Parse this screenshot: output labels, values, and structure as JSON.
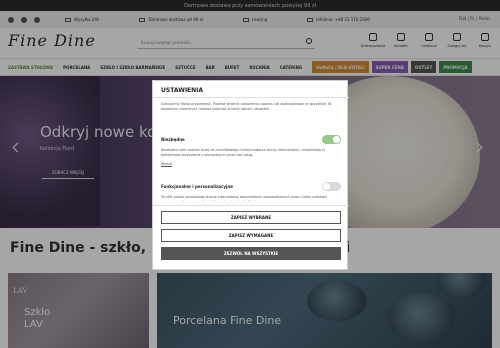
{
  "topbar": {
    "text": "Darmowa dostawa przy zamówieniach powyżej 99 zł"
  },
  "infobar": {
    "social": [
      "facebook-icon",
      "instagram-icon",
      "youtube-icon"
    ],
    "items": [
      "Wysyłka 24h",
      "Darmowa dostawa od 99 zł",
      "Leasing",
      "Infolinia: +48 22 110 2606"
    ],
    "lang": "PLN | PL | Polski"
  },
  "header": {
    "logo": "Fine Dine",
    "search_placeholder": "Szukaj swojego produktu",
    "icons": [
      {
        "name": "rubic-icon",
        "label": "Dostosowanie"
      },
      {
        "name": "contact-icon",
        "label": "Kontakt"
      },
      {
        "name": "heart-icon",
        "label": "Ulubione"
      },
      {
        "name": "account-icon",
        "label": "Zaloguj się"
      },
      {
        "name": "cart-icon",
        "label": "Koszyk"
      }
    ]
  },
  "nav": {
    "items": [
      "ZASTAWA STOŁOWA",
      "PORCELANA",
      "SZKŁO I SZKŁO BARMAŃSKIE",
      "SZTUĆCE",
      "BAR",
      "BUFET",
      "KUCHNIA",
      "CATERING"
    ],
    "pills": [
      {
        "label": "HoReCa / DLA HOTELI",
        "color": "#d88c35"
      },
      {
        "label": "SUPER CENA",
        "color": "#8a5fb6"
      },
      {
        "label": "OUTLET",
        "color": "#555555"
      },
      {
        "label": "PROMOCJA",
        "color": "#3e8e4a"
      }
    ]
  },
  "hero": {
    "title": "Odkryj nowe kol",
    "subtitle": "Kolekcja Fiord",
    "button": "ZOBACZ WIĘCEJ"
  },
  "section": {
    "title": "Fine Dine - szkło, por                                    a domu i gastronomii"
  },
  "tiles": [
    {
      "corner": "LAV",
      "label": "Szkło LAV"
    },
    {
      "label": "Porcelana Fine Dine"
    }
  ],
  "modal": {
    "title": "USTAWIENIA",
    "description": "Szanujemy Twoją prywatność. Możesz zmienić ustawienia cookies lub zaakceptować je wszystkie. W dowolnym momencie możesz dokonać zmiany swoich ustawień.",
    "options": [
      {
        "title": "Niezbędne",
        "body": "Niezbędne pliki cookies służą do prawidłowego funkcjonowania strony internetowej i umożliwiają Ci komfortowe korzystanie z oferowanych przez nas usług.",
        "more": "Więcej",
        "enabled": true
      },
      {
        "title": "Funkcjonalne i personalizacyjne",
        "body": "Te pliki cookie umożliwiają stronie internetowej zapamiętanie wprowadzonych przez Ciebie ustawień oraz personalizację określonych funkcjonalności dla Ciebie.",
        "enabled": false
      }
    ],
    "buttons": {
      "save": "ZAPISZ WYBRANE",
      "save_required": "ZAPISZ WYMAGANE",
      "accept_all": "ZEZWÓL NA WSZYSTKIE"
    }
  }
}
